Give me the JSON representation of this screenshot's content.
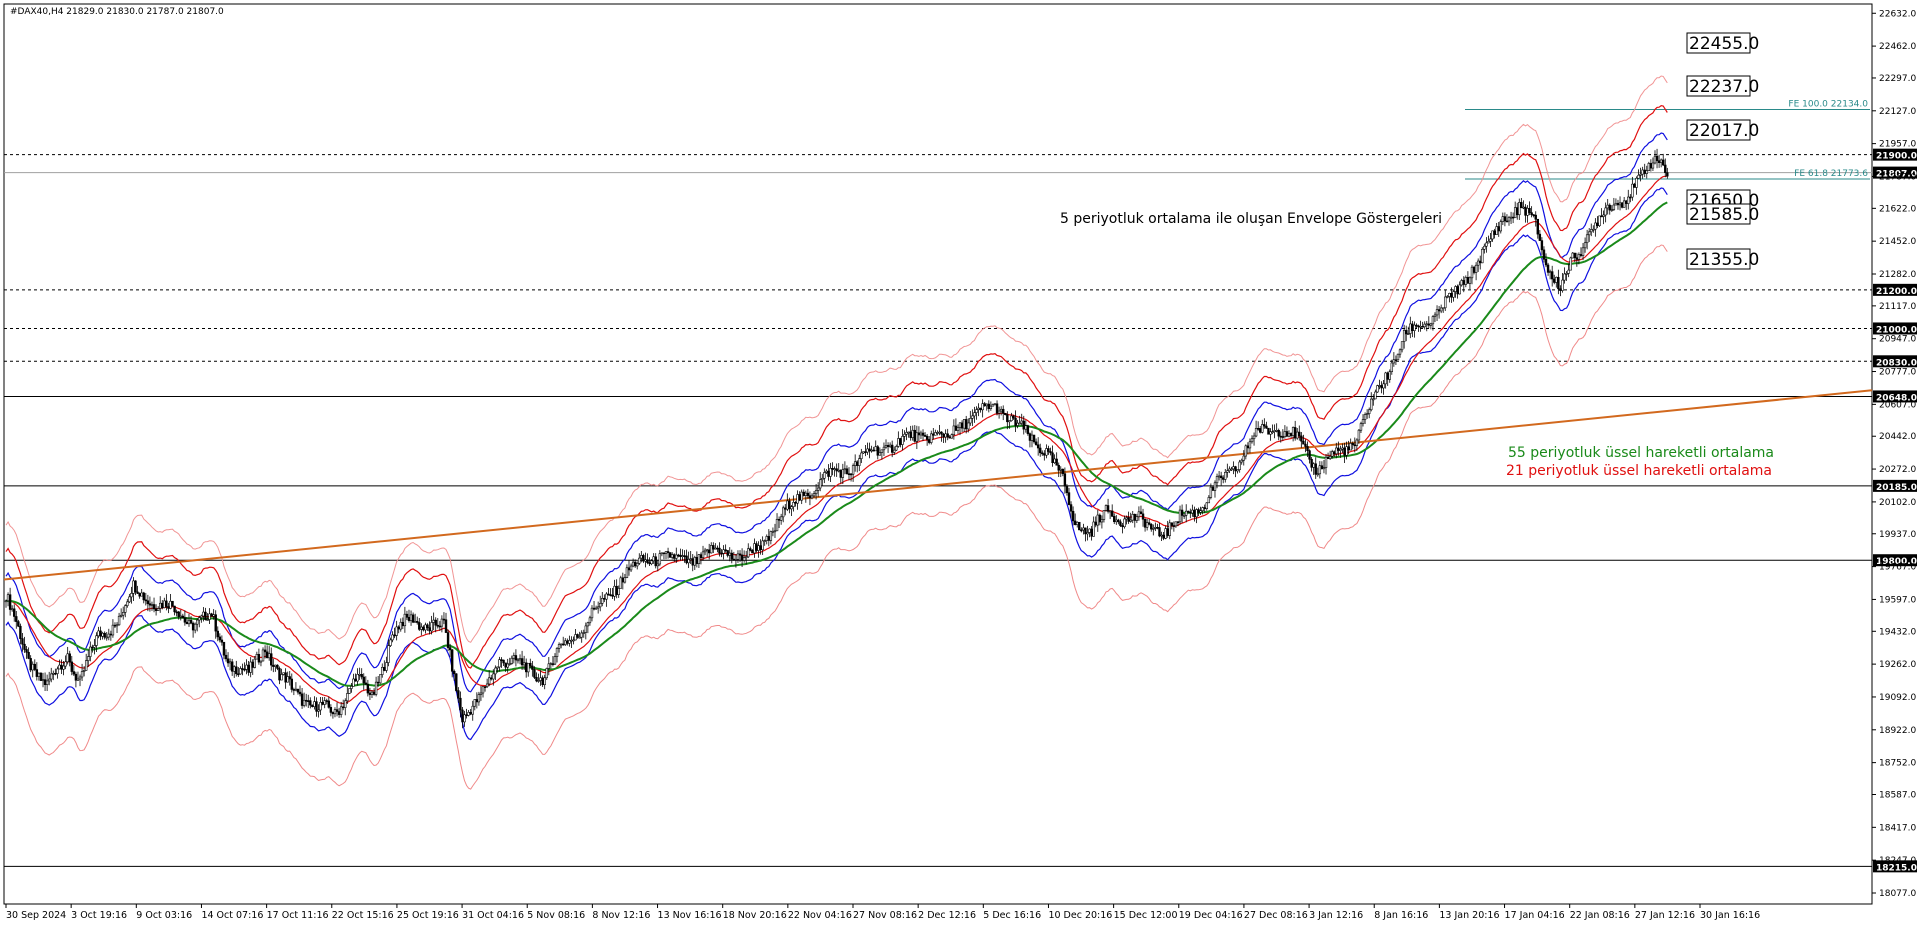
{
  "chart_data": {
    "type": "candlestick",
    "symbol_header": "#DAX40,H4  21829.0 21830.0 21787.0 21807.0",
    "y_axis": {
      "ticks": [
        "22632.0",
        "22462.0",
        "22297.0",
        "22127.0",
        "21957.0",
        "21787.0",
        "21622.0",
        "21452.0",
        "21282.0",
        "21117.0",
        "20947.0",
        "20777.0",
        "20607.0",
        "20442.0",
        "20272.0",
        "20102.0",
        "19937.0",
        "19767.0",
        "19597.0",
        "19432.0",
        "19262.0",
        "19092.0",
        "18922.0",
        "18752.0",
        "18587.0",
        "18417.0",
        "18247.0",
        "18077.0"
      ],
      "range": [
        18020,
        22680
      ]
    },
    "x_axis": {
      "labels": [
        "30 Sep 2024",
        "3 Oct 19:16",
        "9 Oct 03:16",
        "14 Oct 07:16",
        "17 Oct 11:16",
        "22 Oct 15:16",
        "25 Oct 19:16",
        "31 Oct 04:16",
        "5 Nov 08:16",
        "8 Nov 12:16",
        "13 Nov 16:16",
        "18 Nov 20:16",
        "22 Nov 04:16",
        "27 Nov 08:16",
        "2 Dec 12:16",
        "5 Dec 16:16",
        "10 Dec 20:16",
        "15 Dec 12:00",
        "19 Dec 04:16",
        "27 Dec 08:16",
        "3 Jan 12:16",
        "8 Jan 16:16",
        "13 Jan 20:16",
        "17 Jan 04:16",
        "22 Jan 08:16",
        "27 Jan 12:16",
        "30 Jan 16:16"
      ]
    },
    "horizontal_levels": [
      {
        "value": "21900.0",
        "style": "dotted"
      },
      {
        "value": "21807.0",
        "style": "current"
      },
      {
        "value": "21200.0",
        "style": "dotted"
      },
      {
        "value": "21000.0",
        "style": "dotted"
      },
      {
        "value": "20830.0",
        "style": "dotted"
      },
      {
        "value": "20648.0",
        "style": "solid"
      },
      {
        "value": "20185.0",
        "style": "solid"
      },
      {
        "value": "19800.0",
        "style": "solid"
      },
      {
        "value": "18215.0",
        "style": "solid"
      }
    ],
    "envelope_labels": [
      "22455.0",
      "22237.0",
      "22017.0",
      "21650.0",
      "21585.0",
      "21355.0"
    ],
    "fibonacci": [
      {
        "label": "FE 100.0 22134.0",
        "value": 22134
      },
      {
        "label": "FE 61.8 21773.6",
        "value": 21773.6
      }
    ],
    "annotations": {
      "envelope_title": "5 periyotluk ortalama ile oluşan Envelope Göstergeleri",
      "ema55": "55 periyotluk üssel hareketli ortalama",
      "ema21": "21 periyotluk üssel hareketli ortalama"
    },
    "colors": {
      "ema55": "#1a8a1a",
      "ema21": "#e01010",
      "env_inner": "#1010e0",
      "env_mid": "#e01010",
      "env_outer": "#f08a8a",
      "trendline": "#d2691e",
      "fe": "#2a8a8a"
    },
    "price_path": [
      [
        0,
        19620
      ],
      [
        10,
        19300
      ],
      [
        20,
        19150
      ],
      [
        30,
        19300
      ],
      [
        36,
        19180
      ],
      [
        45,
        19400
      ],
      [
        55,
        19500
      ],
      [
        62,
        19650
      ],
      [
        70,
        19600
      ],
      [
        78,
        19560
      ],
      [
        85,
        19520
      ],
      [
        90,
        19480
      ],
      [
        100,
        19500
      ],
      [
        108,
        19280
      ],
      [
        118,
        19200
      ],
      [
        126,
        19360
      ],
      [
        133,
        19200
      ],
      [
        140,
        19120
      ],
      [
        150,
        19050
      ],
      [
        160,
        19000
      ],
      [
        170,
        19200
      ],
      [
        178,
        19080
      ],
      [
        188,
        19420
      ],
      [
        198,
        19500
      ],
      [
        205,
        19460
      ],
      [
        213,
        19450
      ],
      [
        222,
        19000
      ],
      [
        230,
        19060
      ],
      [
        240,
        19300
      ],
      [
        250,
        19250
      ],
      [
        262,
        19200
      ],
      [
        270,
        19350
      ],
      [
        280,
        19450
      ],
      [
        292,
        19600
      ],
      [
        300,
        19720
      ],
      [
        310,
        19790
      ],
      [
        318,
        19830
      ],
      [
        326,
        19790
      ],
      [
        338,
        19820
      ],
      [
        350,
        19850
      ],
      [
        360,
        19810
      ],
      [
        368,
        19880
      ],
      [
        376,
        20020
      ],
      [
        386,
        20120
      ],
      [
        395,
        20200
      ],
      [
        403,
        20250
      ],
      [
        410,
        20280
      ],
      [
        420,
        20350
      ],
      [
        430,
        20400
      ],
      [
        440,
        20430
      ],
      [
        450,
        20460
      ],
      [
        458,
        20420
      ],
      [
        466,
        20530
      ],
      [
        474,
        20560
      ],
      [
        482,
        20600
      ],
      [
        490,
        20520
      ],
      [
        498,
        20420
      ],
      [
        506,
        20380
      ],
      [
        514,
        20200
      ],
      [
        520,
        20000
      ],
      [
        528,
        19950
      ],
      [
        536,
        20050
      ],
      [
        545,
        20020
      ],
      [
        555,
        19980
      ],
      [
        565,
        19950
      ],
      [
        575,
        20050
      ],
      [
        583,
        20100
      ],
      [
        592,
        20220
      ],
      [
        600,
        20320
      ],
      [
        608,
        20450
      ],
      [
        618,
        20500
      ],
      [
        628,
        20420
      ],
      [
        638,
        20280
      ],
      [
        648,
        20350
      ],
      [
        656,
        20420
      ],
      [
        664,
        20600
      ],
      [
        672,
        20780
      ],
      [
        680,
        20950
      ],
      [
        688,
        21020
      ],
      [
        696,
        21080
      ],
      [
        704,
        21160
      ],
      [
        712,
        21300
      ],
      [
        720,
        21400
      ],
      [
        728,
        21580
      ],
      [
        736,
        21620
      ],
      [
        744,
        21540
      ],
      [
        750,
        21320
      ],
      [
        756,
        21200
      ],
      [
        762,
        21350
      ],
      [
        770,
        21500
      ],
      [
        778,
        21600
      ],
      [
        786,
        21680
      ],
      [
        794,
        21750
      ],
      [
        800,
        21850
      ],
      [
        805,
        21900
      ],
      [
        808,
        21807
      ]
    ],
    "price_scale": "bar_index_to_price"
  }
}
